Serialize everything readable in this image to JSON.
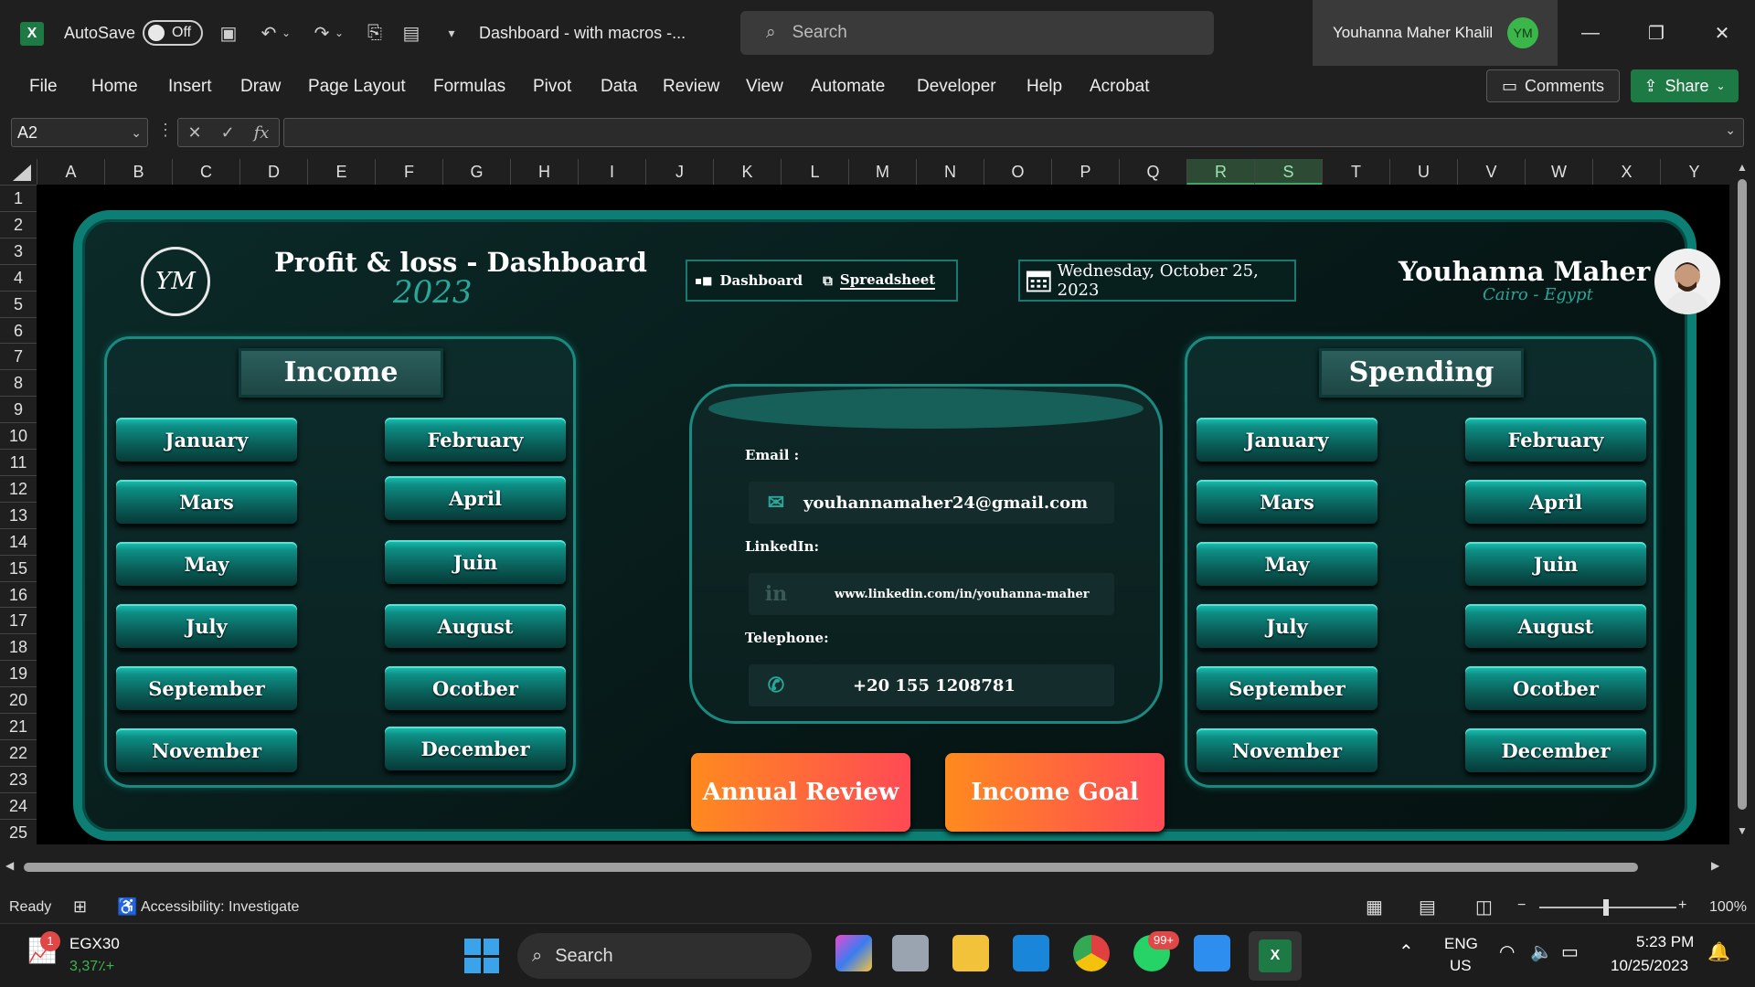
{
  "titlebar": {
    "autosave_label": "AutoSave",
    "autosave_state": "Off",
    "doc_title": "Dashboard - with macros  -...",
    "search_placeholder": "Search",
    "user_name": "Youhanna Maher Khalil",
    "user_initials": "YM"
  },
  "menu": {
    "items": [
      "File",
      "Home",
      "Insert",
      "Draw",
      "Page Layout",
      "Formulas",
      "Pivot",
      "Data",
      "Review",
      "View",
      "Automate",
      "Developer",
      "Help",
      "Acrobat"
    ],
    "comments": "Comments",
    "share": "Share"
  },
  "formula": {
    "name_box": "A2",
    "fx": "fx",
    "value": ""
  },
  "grid": {
    "columns": [
      "A",
      "B",
      "C",
      "D",
      "E",
      "F",
      "G",
      "H",
      "I",
      "J",
      "K",
      "L",
      "M",
      "N",
      "O",
      "P",
      "Q",
      "R",
      "S",
      "T",
      "U",
      "V",
      "W",
      "X",
      "Y"
    ],
    "selected_columns": [
      "R",
      "S"
    ],
    "rows": [
      "1",
      "2",
      "3",
      "4",
      "5",
      "6",
      "7",
      "8",
      "9",
      "10",
      "11",
      "12",
      "13",
      "14",
      "15",
      "16",
      "17",
      "18",
      "19",
      "20",
      "21",
      "22",
      "23",
      "24",
      "25"
    ]
  },
  "dashboard": {
    "logo_text": "YM",
    "title": "Profit & loss - Dashboard",
    "year": "2023",
    "nav": {
      "dashboard": "Dashboard",
      "spreadsheet": "Spreadsheet"
    },
    "date": "Wednesday, October 25, 2023",
    "user_name": "Youhanna Maher",
    "user_location": "Cairo - Egypt",
    "income": {
      "title": "Income",
      "months": [
        "January",
        "February",
        "Mars",
        "April",
        "May",
        "Juin",
        "July",
        "August",
        "September",
        "Ocotber",
        "November",
        "December"
      ]
    },
    "spending": {
      "title": "Spending",
      "months": [
        "January",
        "February",
        "Mars",
        "April",
        "May",
        "Juin",
        "July",
        "August",
        "September",
        "Ocotber",
        "November",
        "December"
      ]
    },
    "contact": {
      "email_label": "Email :",
      "email": "youhannamaher24@gmail.com",
      "linkedin_label": "LinkedIn:",
      "linkedin": "www.linkedin.com/in/youhanna-maher",
      "phone_label": "Telephone:",
      "phone": "+20 155 1208781"
    },
    "buttons": {
      "annual_review": "Annual Review",
      "income_goal": "Income Goal"
    }
  },
  "status": {
    "ready": "Ready",
    "accessibility": "Accessibility: Investigate",
    "zoom": "100%"
  },
  "taskbar": {
    "ticker_name": "EGX30",
    "ticker_value": "3,37٪+",
    "ticker_badge": "1",
    "search": "Search",
    "whatsapp_badge": "99+",
    "lang_top": "ENG",
    "lang_bottom": "US",
    "time": "5:23 PM",
    "date": "10/25/2023"
  },
  "colors": {
    "accent_teal": "#0c7e74",
    "excel_green": "#1e7a45",
    "button_orange": "#ff8a1e",
    "button_red": "#ff4a55"
  }
}
